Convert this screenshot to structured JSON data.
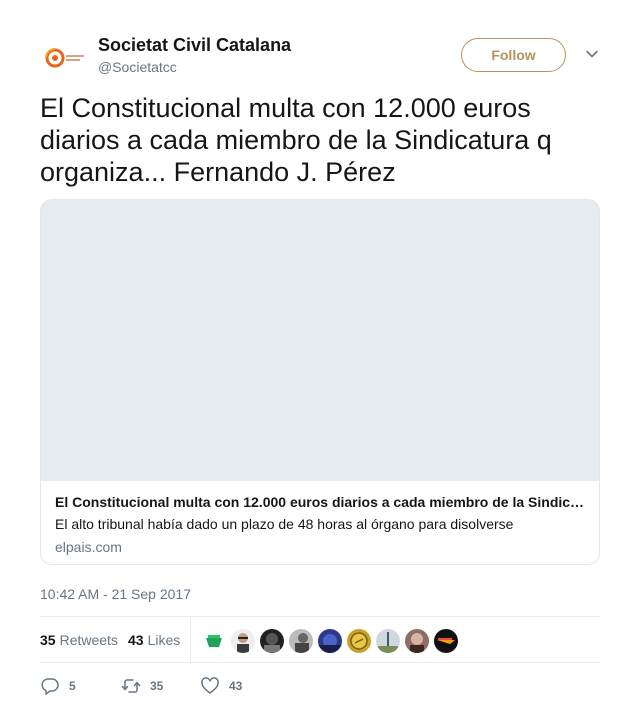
{
  "account": {
    "name": "Societat Civil Catalana",
    "handle": "@Societatcc",
    "follow_label": "Follow"
  },
  "tweet": {
    "text": "El Constitucional multa con 12.000 euros diarios a cada miembro de la Sindicatura q organiza... Fernando J. Pérez",
    "timestamp": "10:42 AM - 21 Sep 2017"
  },
  "card": {
    "title": "El Constitucional multa con 12.000 euros diarios a cada miembro de la Sindicatura",
    "description": "El alto tribunal había dado un plazo de 48 horas al órgano para disolverse",
    "domain": "elpais.com"
  },
  "stats": {
    "retweets_count": "35",
    "retweets_label": "Retweets",
    "likes_count": "43",
    "likes_label": "Likes"
  },
  "actions": {
    "reply_count": "5",
    "retweet_count": "35",
    "like_count": "43"
  },
  "colors": {
    "follow_accent": "#b7925c",
    "secondary_text": "#657786",
    "primary_text": "#14171a",
    "logo_orange": "#e8641b"
  },
  "icons": {
    "reply": "reply-icon",
    "retweet": "retweet-icon",
    "like": "heart-icon",
    "caret": "chevron-down-icon"
  }
}
